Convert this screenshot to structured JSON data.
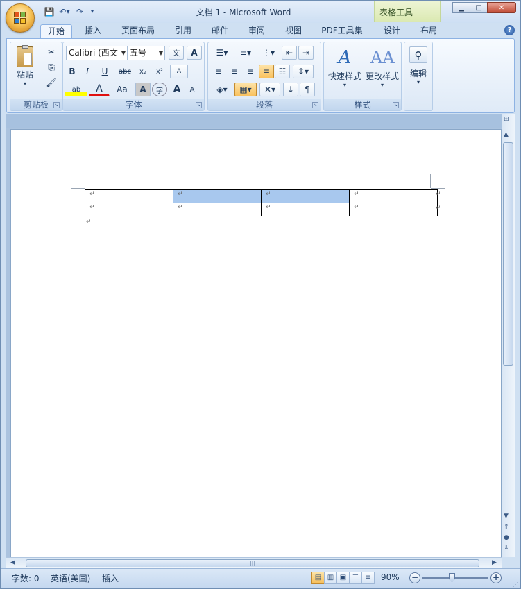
{
  "window": {
    "title": "文档 1 - Microsoft Word",
    "contextual_tab": "表格工具"
  },
  "qat": {
    "save_icon": "save-icon",
    "undo_icon": "undo-icon",
    "redo_icon": "redo-icon"
  },
  "tabs": [
    "开始",
    "插入",
    "页面布局",
    "引用",
    "邮件",
    "审阅",
    "视图",
    "PDF工具集",
    "设计",
    "布局"
  ],
  "ribbon": {
    "clipboard": {
      "label": "剪贴板",
      "paste": "粘贴"
    },
    "font": {
      "label": "字体",
      "font_name": "Calibri (西文",
      "font_size": "五号",
      "bold": "B",
      "italic": "I",
      "underline": "U",
      "strike": "abc",
      "subscript": "x₂",
      "superscript": "x²",
      "grow": "A",
      "shrink": "A",
      "case": "Aa",
      "char_shade": "A",
      "enclose": "字",
      "highlight": "ab",
      "color": "A",
      "phonetic": "文",
      "border": "A",
      "clear": "A"
    },
    "paragraph": {
      "label": "段落"
    },
    "styles": {
      "label": "样式",
      "quick": "快速样式",
      "change": "更改样式"
    },
    "editing": {
      "label": "编辑"
    }
  },
  "document": {
    "rows": 2,
    "cols": 4,
    "paragraph_mark": "↵"
  },
  "status": {
    "word_count": "字数: 0",
    "language": "英语(美国)",
    "mode": "插入",
    "zoom": "90%"
  },
  "colors": {
    "accent": "#2a5699",
    "highlight": "#a8c8ee",
    "font_color": "#e01010",
    "highlight_color": "#ffff00"
  }
}
